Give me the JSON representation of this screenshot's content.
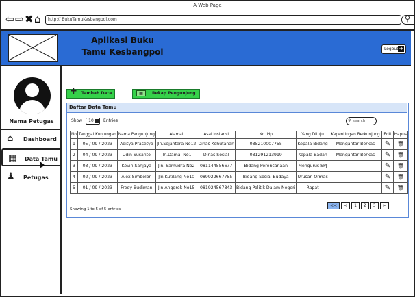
{
  "browser": {
    "window_title": "A Web Page",
    "url": "http:// BukuTamuKesbangpol.com"
  },
  "header": {
    "title": "Aplikasi Buku Tamu Kesbangpol",
    "logout_label": "Logout"
  },
  "sidebar": {
    "user_name": "Nama Petugas",
    "items": [
      {
        "label": "Dashboard",
        "icon": "home-icon"
      },
      {
        "label": "Data Tamu",
        "icon": "book-icon",
        "active": true
      },
      {
        "label": "Petugas",
        "icon": "add-user-icon"
      }
    ]
  },
  "actions": {
    "tambah_label": "Tambah Data",
    "rekap_label": "Rekap Pengunjung"
  },
  "panel": {
    "title": "Daftar Data Tamu",
    "show_label": "Show",
    "show_value": "10",
    "entries_label": "Entries",
    "search_placeholder": "search"
  },
  "table": {
    "columns": [
      "No",
      "Tanggal Kunjungan",
      "Nama Pengunjung",
      "Alamat",
      "Asal Instansi",
      "No. Hp",
      "Yang Dituju",
      "Kepentingan Berkunjung",
      "Edit",
      "Hapus"
    ],
    "rows": [
      {
        "no": "1",
        "tanggal": "05 / 09 / 2023",
        "nama": "Aditya Prasetyo",
        "alamat": "Jln.Sejahtera No12",
        "instansi": "Dinas Kehutanan",
        "hp": "085210007755",
        "dituju": "Kepala Bidang",
        "kepentingan": "Mengantar Berkas"
      },
      {
        "no": "2",
        "tanggal": "04 / 09 / 2023",
        "nama": "Udin Susanto",
        "alamat": "Jln.Damai No1",
        "instansi": "Dinas Sosial",
        "hp": "081291213919",
        "dituju": "Kepala Badan",
        "kepentingan": "Mengantar Berkas"
      },
      {
        "no": "3",
        "tanggal": "03 / 09 / 2023",
        "nama": "Kevin Sanjaya",
        "alamat": "Jln. Samudra No2",
        "instansi": "081144556677",
        "hp": "Bidang Perencanaan",
        "dituju": "Mengurus SPJ",
        "kepentingan": ""
      },
      {
        "no": "4",
        "tanggal": "02 / 09 / 2023",
        "nama": "Alex Simbolon",
        "alamat": "Jln.Kutilang No10",
        "instansi": "089922667755",
        "hp": "Bidang Sosial Budaya",
        "dituju": "Urusan Ormas",
        "kepentingan": ""
      },
      {
        "no": "5",
        "tanggal": "01 / 09 / 2023",
        "nama": "Fredy Budiman",
        "alamat": "Jln.Anggrek No15",
        "instansi": "081924567843",
        "hp": "Bidang Politik Dalam Negeri",
        "dituju": "Rapat",
        "kepentingan": ""
      }
    ]
  },
  "footer": {
    "info": "Showing 1 to 5 of 5 entries",
    "pages": [
      "<<",
      "<",
      "1",
      "2",
      "3",
      ">"
    ]
  }
}
